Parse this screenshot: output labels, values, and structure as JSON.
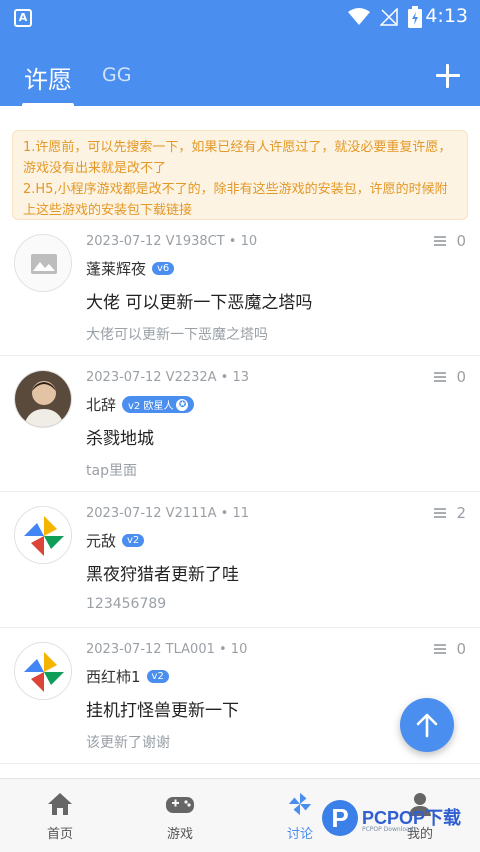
{
  "status_bar": {
    "time": "4:13",
    "app_icon_letter": "A"
  },
  "header": {
    "tabs": [
      {
        "label": "许愿",
        "active": true
      },
      {
        "label": "GG",
        "active": false
      }
    ],
    "add_icon": "plus-icon"
  },
  "notice": {
    "line1": "1.许愿前，可以先搜索一下，如果已经有人许愿过了，就没必要重复许愿，游戏没有出来就是改不了",
    "line2": "2.H5,小程序游戏都是改不了的，除非有这些游戏的安装包，许愿的时候附上这些游戏的安装包下载链接"
  },
  "posts": [
    {
      "meta": "2023-07-12 V1938CT • 10",
      "replies": "0",
      "username": "蓬莱辉夜",
      "level": "v6",
      "title": "大佬 可以更新一下恶魔之塔吗",
      "body": "大佬可以更新一下恶魔之塔吗",
      "avatar": "image-placeholder-icon"
    },
    {
      "meta": "2023-07-12 V2232A • 13",
      "replies": "0",
      "username": "北辞",
      "level": "v2 欧星人",
      "level_star": "✪",
      "title": "杀戮地城",
      "body": "tap里面",
      "avatar": "user-photo"
    },
    {
      "meta": "2023-07-12 V2111A • 11",
      "replies": "2",
      "username": "元敌",
      "level": "v2",
      "title": "黑夜狩猎者更新了哇",
      "body": "123456789",
      "avatar": "pinwheel-icon"
    },
    {
      "meta": "2023-07-12 TLA001 • 10",
      "replies": "0",
      "username": "西红柿1",
      "level": "v2",
      "title": "挂机打怪兽更新一下",
      "body": "该更新了谢谢",
      "avatar": "pinwheel-icon"
    }
  ],
  "bottom_nav": [
    {
      "label": "首页",
      "icon": "home-icon",
      "active": false
    },
    {
      "label": "游戏",
      "icon": "gamepad-icon",
      "active": false
    },
    {
      "label": "讨论",
      "icon": "pinwheel-icon",
      "active": true
    },
    {
      "label": "我的",
      "icon": "person-icon",
      "active": false
    }
  ],
  "watermark": {
    "logo": "P",
    "text": "PCPOP下载",
    "sub": "PCPOP Download"
  },
  "colors": {
    "primary": "#4a8ef0",
    "notice_bg": "#fdf3e3",
    "notice_text": "#e39826"
  }
}
